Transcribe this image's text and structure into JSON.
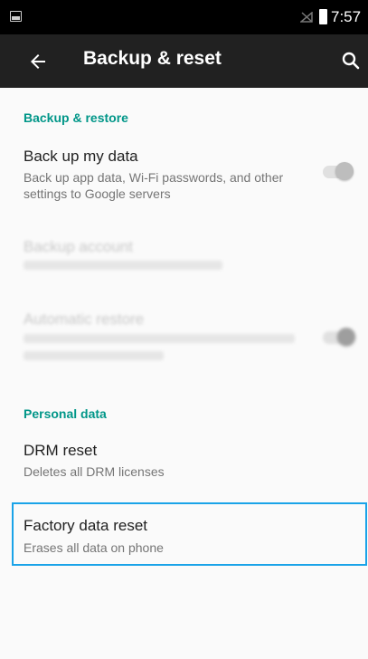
{
  "status_bar": {
    "time": "7:57"
  },
  "app_bar": {
    "title": "Backup & reset"
  },
  "sections": {
    "backup": {
      "header": "Backup & restore",
      "back_up_my_data": {
        "title": "Back up my data",
        "summary": "Back up app data, Wi-Fi passwords, and other settings to Google servers"
      },
      "backup_account": {
        "title": "Backup account"
      },
      "automatic_restore": {
        "title": "Automatic restore"
      }
    },
    "personal": {
      "header": "Personal data",
      "drm_reset": {
        "title": "DRM reset",
        "summary": "Deletes all DRM licenses"
      },
      "factory_reset": {
        "title": "Factory data reset",
        "summary": "Erases all data on phone"
      }
    }
  },
  "colors": {
    "accent": "#009688",
    "highlight": "#1aa3e8"
  }
}
